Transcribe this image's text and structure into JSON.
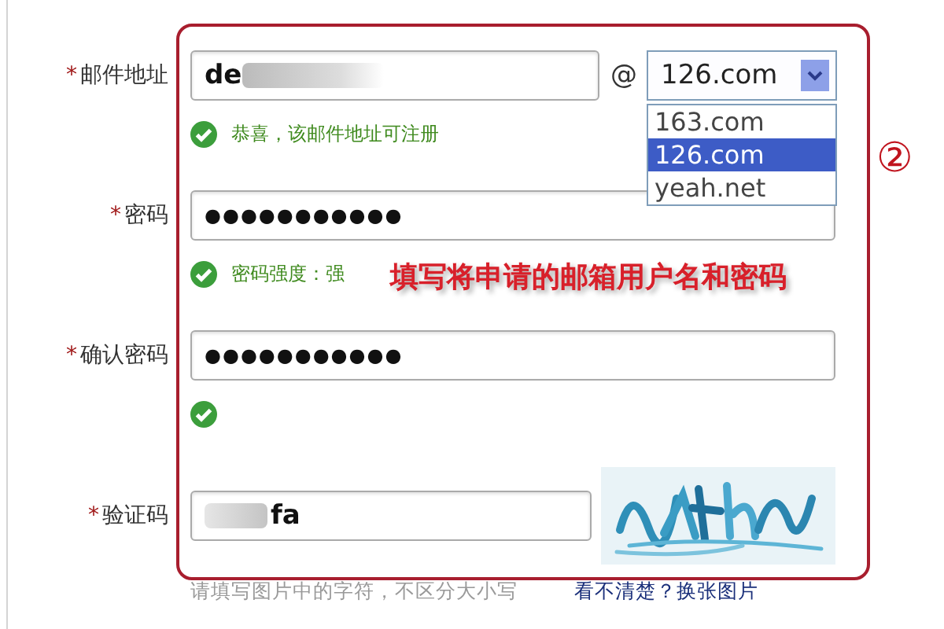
{
  "fields": [
    {
      "kind": "email",
      "marker": "*",
      "label": "邮件地址",
      "value": "de",
      "blur_after": true,
      "separator": "@",
      "domain": {
        "value": "126.com",
        "expanded": true,
        "options": [
          {
            "label": "163.com",
            "selected": false
          },
          {
            "label": "126.com",
            "selected": true
          },
          {
            "label": "yeah.net",
            "selected": false
          }
        ]
      },
      "hint": {
        "valid": true,
        "text": "恭喜，该邮件地址可注册"
      }
    },
    {
      "kind": "password",
      "marker": "*",
      "label": "密码",
      "value": "●●●●●●●●●●●",
      "hint": {
        "valid": true,
        "text": "密码强度：强"
      }
    },
    {
      "kind": "password",
      "marker": "*",
      "label": "确认密码",
      "value": "●●●●●●●●●●●",
      "hint": {
        "valid": true
      }
    },
    {
      "kind": "captcha",
      "marker": "*",
      "label": "验证码",
      "value": "fa",
      "blur_before": true,
      "hint": {
        "text": "请填写图片中的字符，不区分大小写",
        "link": "看不清楚？换张图片"
      }
    }
  ],
  "annotation": {
    "text": "填写将申请的邮箱用户名和密码",
    "step": "②"
  }
}
